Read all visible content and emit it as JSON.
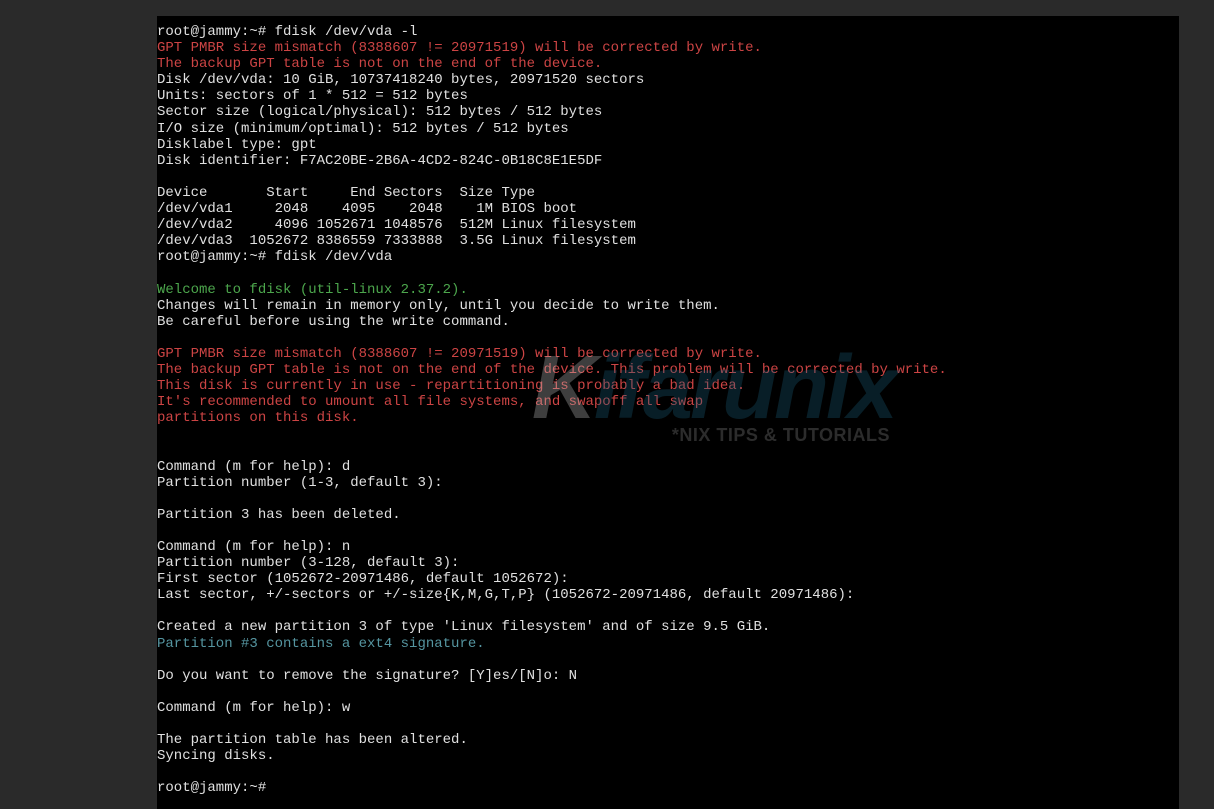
{
  "terminal": {
    "lines": [
      {
        "text": "root@jammy:~# fdisk /dev/vda -l",
        "class": ""
      },
      {
        "text": "GPT PMBR size mismatch (8388607 != 20971519) will be corrected by write.",
        "class": "red"
      },
      {
        "text": "The backup GPT table is not on the end of the device.",
        "class": "red"
      },
      {
        "text": "Disk /dev/vda: 10 GiB, 10737418240 bytes, 20971520 sectors",
        "class": ""
      },
      {
        "text": "Units: sectors of 1 * 512 = 512 bytes",
        "class": ""
      },
      {
        "text": "Sector size (logical/physical): 512 bytes / 512 bytes",
        "class": ""
      },
      {
        "text": "I/O size (minimum/optimal): 512 bytes / 512 bytes",
        "class": ""
      },
      {
        "text": "Disklabel type: gpt",
        "class": ""
      },
      {
        "text": "Disk identifier: F7AC20BE-2B6A-4CD2-824C-0B18C8E1E5DF",
        "class": ""
      },
      {
        "text": "",
        "class": ""
      },
      {
        "text": "Device       Start     End Sectors  Size Type",
        "class": ""
      },
      {
        "text": "/dev/vda1     2048    4095    2048    1M BIOS boot",
        "class": ""
      },
      {
        "text": "/dev/vda2     4096 1052671 1048576  512M Linux filesystem",
        "class": ""
      },
      {
        "text": "/dev/vda3  1052672 8386559 7333888  3.5G Linux filesystem",
        "class": ""
      },
      {
        "text": "root@jammy:~# fdisk /dev/vda",
        "class": ""
      },
      {
        "text": "",
        "class": ""
      },
      {
        "text": "Welcome to fdisk (util-linux 2.37.2).",
        "class": "green"
      },
      {
        "text": "Changes will remain in memory only, until you decide to write them.",
        "class": ""
      },
      {
        "text": "Be careful before using the write command.",
        "class": ""
      },
      {
        "text": "",
        "class": ""
      },
      {
        "text": "GPT PMBR size mismatch (8388607 != 20971519) will be corrected by write.",
        "class": "red"
      },
      {
        "text": "The backup GPT table is not on the end of the device. This problem will be corrected by write.",
        "class": "red"
      },
      {
        "text": "This disk is currently in use - repartitioning is probably a bad idea.",
        "class": "red"
      },
      {
        "text": "It's recommended to umount all file systems, and swapoff all swap",
        "class": "red"
      },
      {
        "text": "partitions on this disk.",
        "class": "red"
      },
      {
        "text": "",
        "class": ""
      },
      {
        "text": "",
        "class": ""
      },
      {
        "text": "Command (m for help): d",
        "class": ""
      },
      {
        "text": "Partition number (1-3, default 3): ",
        "class": ""
      },
      {
        "text": "",
        "class": ""
      },
      {
        "text": "Partition 3 has been deleted.",
        "class": ""
      },
      {
        "text": "",
        "class": ""
      },
      {
        "text": "Command (m for help): n",
        "class": ""
      },
      {
        "text": "Partition number (3-128, default 3): ",
        "class": ""
      },
      {
        "text": "First sector (1052672-20971486, default 1052672): ",
        "class": ""
      },
      {
        "text": "Last sector, +/-sectors or +/-size{K,M,G,T,P} (1052672-20971486, default 20971486): ",
        "class": ""
      },
      {
        "text": "",
        "class": ""
      },
      {
        "text": "Created a new partition 3 of type 'Linux filesystem' and of size 9.5 GiB.",
        "class": ""
      },
      {
        "text": "Partition #3 contains a ext4 signature.",
        "class": "cyan"
      },
      {
        "text": "",
        "class": ""
      },
      {
        "text": "Do you want to remove the signature? [Y]es/[N]o: N",
        "class": ""
      },
      {
        "text": "",
        "class": ""
      },
      {
        "text": "Command (m for help): w",
        "class": ""
      },
      {
        "text": "",
        "class": ""
      },
      {
        "text": "The partition table has been altered.",
        "class": ""
      },
      {
        "text": "Syncing disks.",
        "class": ""
      },
      {
        "text": "",
        "class": ""
      },
      {
        "text": "root@jammy:~# ",
        "class": ""
      }
    ]
  },
  "watermark": {
    "main_k": "K",
    "main_rest": "ifarunix",
    "sub": "*NIX TIPS & TUTORIALS"
  }
}
